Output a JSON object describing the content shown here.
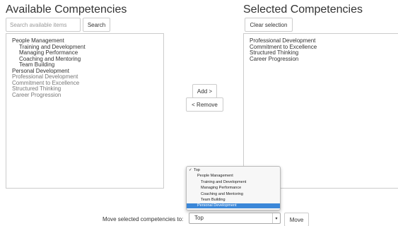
{
  "available": {
    "title": "Available Competencies",
    "search_placeholder": "Search available items",
    "search_label": "Search",
    "items": [
      {
        "label": "People Management",
        "indent": 0,
        "muted": false
      },
      {
        "label": "Training and Development",
        "indent": 1,
        "muted": false
      },
      {
        "label": "Managing Performance",
        "indent": 1,
        "muted": false
      },
      {
        "label": "Coaching and Mentoring",
        "indent": 1,
        "muted": false
      },
      {
        "label": "Team Building",
        "indent": 1,
        "muted": false
      },
      {
        "label": "Personal Development",
        "indent": 0,
        "muted": false
      },
      {
        "label": "Professional Development",
        "indent": 0,
        "muted": true
      },
      {
        "label": "Commitment to Excellence",
        "indent": 0,
        "muted": true
      },
      {
        "label": "Structured Thinking",
        "indent": 0,
        "muted": true
      },
      {
        "label": "Career Progression",
        "indent": 0,
        "muted": true
      }
    ]
  },
  "selected": {
    "title": "Selected Competencies",
    "clear_label": "Clear selection",
    "items": [
      {
        "label": "Professional Development"
      },
      {
        "label": "Commitment to Excellence"
      },
      {
        "label": "Structured Thinking"
      },
      {
        "label": "Career Progression"
      }
    ]
  },
  "actions": {
    "add_label": "Add >",
    "remove_label": "< Remove"
  },
  "move": {
    "label": "Move selected competencies to:",
    "selected_value": "Top",
    "button_label": "Move",
    "checkmark": "✓",
    "dropdown_options": [
      {
        "label": "Top",
        "indent": 0,
        "checked": true,
        "highlighted": false
      },
      {
        "label": "People Management",
        "indent": 1,
        "checked": false,
        "highlighted": false
      },
      {
        "label": "Training and Development",
        "indent": 2,
        "checked": false,
        "highlighted": false
      },
      {
        "label": "Managing Performance",
        "indent": 2,
        "checked": false,
        "highlighted": false
      },
      {
        "label": "Coaching and Mentoring",
        "indent": 2,
        "checked": false,
        "highlighted": false
      },
      {
        "label": "Team Building",
        "indent": 2,
        "checked": false,
        "highlighted": false
      },
      {
        "label": "Personal Development",
        "indent": 1,
        "checked": false,
        "highlighted": true
      }
    ]
  },
  "colors": {
    "highlight": "#3b87d8",
    "border": "#cccccc"
  }
}
